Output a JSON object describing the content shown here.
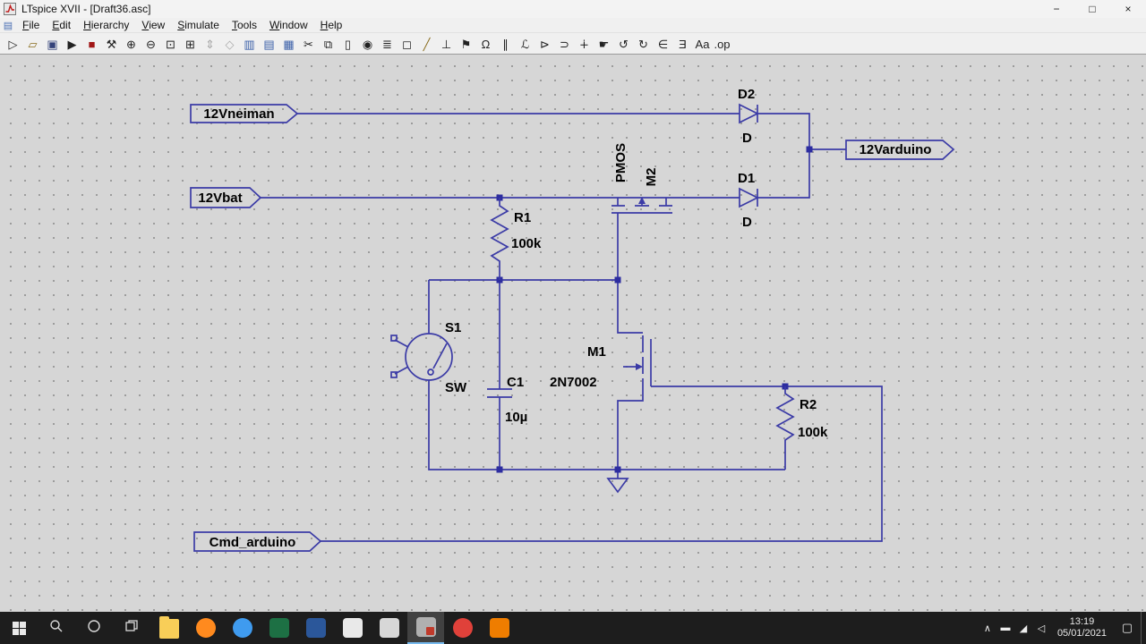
{
  "titlebar": {
    "title": "LTspice XVII - [Draft36.asc]",
    "controls": {
      "minimize": "−",
      "maximize": "□",
      "close": "×"
    }
  },
  "menubar": {
    "doc_icon_glyph": "▤",
    "items": [
      "File",
      "Edit",
      "Hierarchy",
      "View",
      "Simulate",
      "Tools",
      "Window",
      "Help"
    ]
  },
  "toolbar": {
    "icons": [
      {
        "name": "new-schematic",
        "glyph": "▷"
      },
      {
        "name": "open-file",
        "glyph": "▱",
        "color": "#8a6d1f"
      },
      {
        "name": "save",
        "glyph": "▣",
        "color": "#34437a"
      },
      {
        "name": "run",
        "glyph": "▶"
      },
      {
        "name": "halt",
        "glyph": "■",
        "color": "#a11616"
      },
      {
        "name": "control-panel",
        "glyph": "⚒"
      },
      {
        "name": "zoom-in",
        "glyph": "⊕"
      },
      {
        "name": "zoom-out",
        "glyph": "⊖"
      },
      {
        "name": "zoom-area",
        "glyph": "⊡"
      },
      {
        "name": "zoom-fit",
        "glyph": "⊞"
      },
      {
        "name": "autorange",
        "glyph": "⇕",
        "disabled": true
      },
      {
        "name": "pan",
        "glyph": "◇",
        "disabled": true
      },
      {
        "name": "tile-vertical",
        "glyph": "▥",
        "color": "#3a5fa8"
      },
      {
        "name": "tile-horizontal",
        "glyph": "▤",
        "color": "#3a5fa8"
      },
      {
        "name": "cascade-windows",
        "glyph": "▦",
        "color": "#3a5fa8"
      },
      {
        "name": "cut",
        "glyph": "✂"
      },
      {
        "name": "copy",
        "glyph": "⧉"
      },
      {
        "name": "paste",
        "glyph": "▯"
      },
      {
        "name": "find",
        "glyph": "◉"
      },
      {
        "name": "print",
        "glyph": "≣"
      },
      {
        "name": "print-preview",
        "glyph": "◻"
      },
      {
        "name": "draw-wire",
        "glyph": "╱",
        "color": "#8a6d1f"
      },
      {
        "name": "ground",
        "glyph": "⊥"
      },
      {
        "name": "label-net",
        "glyph": "⚑"
      },
      {
        "name": "resistor",
        "glyph": "Ω"
      },
      {
        "name": "capacitor",
        "glyph": "∥"
      },
      {
        "name": "inductor",
        "glyph": "ℒ"
      },
      {
        "name": "diode",
        "glyph": "⊳"
      },
      {
        "name": "component",
        "glyph": "⊃"
      },
      {
        "name": "move",
        "glyph": "∔"
      },
      {
        "name": "drag",
        "glyph": "☛"
      },
      {
        "name": "undo",
        "glyph": "↺"
      },
      {
        "name": "redo",
        "glyph": "↻"
      },
      {
        "name": "rotate",
        "glyph": "∈"
      },
      {
        "name": "mirror",
        "glyph": "Ǝ"
      },
      {
        "name": "text",
        "glyph": "Aa"
      },
      {
        "name": "spice-directive",
        "glyph": ".op"
      }
    ]
  },
  "schematic": {
    "colors": {
      "wire": "#3b3ba6",
      "junction": "#2d2da0",
      "label_text": "#000000"
    },
    "nets": {
      "neiman": "12Vneiman",
      "bat": "12Vbat",
      "arduino": "12Varduino",
      "cmd": "Cmd_arduino"
    },
    "d2": {
      "name": "D2",
      "value": "D"
    },
    "d1": {
      "name": "D1",
      "value": "D"
    },
    "r1": {
      "name": "R1",
      "value": "100k"
    },
    "r2": {
      "name": "R2",
      "value": "100k"
    },
    "m2": {
      "name": "M2",
      "value": "PMOS"
    },
    "m1": {
      "name": "M1",
      "value": "2N7002"
    },
    "s1": {
      "name": "S1",
      "value": "SW"
    },
    "c1": {
      "name": "C1",
      "value": "10µ"
    }
  },
  "taskbar": {
    "apps": [
      {
        "name": "file-explorer",
        "color": "#f8ce58",
        "shape": "folder"
      },
      {
        "name": "firefox",
        "color": "#ff8a1e",
        "shape": "circle"
      },
      {
        "name": "thunderbird",
        "color": "#3f9bef",
        "shape": "circle"
      },
      {
        "name": "excel",
        "color": "#1d7044",
        "shape": "square"
      },
      {
        "name": "word",
        "color": "#2b579a",
        "shape": "square"
      },
      {
        "name": "notepad",
        "color": "#e9e9e9",
        "shape": "square"
      },
      {
        "name": "miktex",
        "color": "#d7d7d7",
        "shape": "square"
      },
      {
        "name": "ltspice",
        "color": "#b0b0b0",
        "shape": "square",
        "active": true
      },
      {
        "name": "opera",
        "color": "#e0413a",
        "shape": "circle"
      },
      {
        "name": "vlc",
        "color": "#ef7d00",
        "shape": "square"
      }
    ],
    "tray": [
      {
        "name": "hidden-icons-chevron",
        "glyph": "∧"
      },
      {
        "name": "battery",
        "glyph": "▬"
      },
      {
        "name": "network",
        "glyph": "◢"
      },
      {
        "name": "volume",
        "glyph": "◁"
      }
    ],
    "time": "13:19",
    "date": "05/01/2021",
    "action_center_glyph": "▢"
  }
}
